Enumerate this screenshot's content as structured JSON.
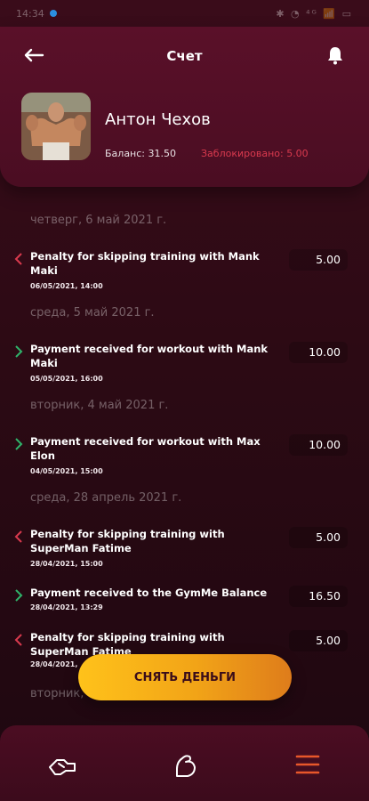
{
  "status_bar": {
    "time": "14:34",
    "right": "✱ ◔ ⁴ᴳ 📶 ▭"
  },
  "header": {
    "title": "Счет",
    "user_name": "Антон Чехов",
    "balance_text": "Баланс: 31.50",
    "blocked_text": "Заблокировано: 5.00"
  },
  "feed": {
    "dates": [
      "четверг, 6 май 2021 г.",
      "среда, 5 май 2021 г.",
      "вторник, 4 май 2021 г.",
      "среда, 28 апрель 2021 г.",
      "вторник,"
    ],
    "transactions": [
      {
        "direction": "out",
        "description": "Penalty for skipping training with Mank Maki",
        "time": "06/05/2021, 14:00",
        "amount": "5.00"
      },
      {
        "direction": "in",
        "description": "Payment received for workout with Mank Maki",
        "time": "05/05/2021, 16:00",
        "amount": "10.00"
      },
      {
        "direction": "in",
        "description": "Payment received for workout with Max Elon",
        "time": "04/05/2021, 15:00",
        "amount": "10.00"
      },
      {
        "direction": "out",
        "description": "Penalty for skipping training with SuperMan Fatime",
        "time": "28/04/2021, 15:00",
        "amount": "5.00"
      },
      {
        "direction": "in",
        "description": "Payment received to the GymMe Balance",
        "time": "28/04/2021, 13:29",
        "amount": "16.50"
      },
      {
        "direction": "out",
        "description": "Penalty for skipping training with SuperMan Fatime",
        "time": "28/04/2021,",
        "amount": "5.00"
      }
    ]
  },
  "withdraw_button": "СНЯТЬ ДЕНЬГИ",
  "colors": {
    "accent": "#f2a417",
    "incoming": "#2fb36a",
    "outgoing": "#d93a4e",
    "menu_active": "#e8572a"
  },
  "tabbar": {
    "icons": [
      "handshake-icon",
      "bicep-icon",
      "menu-icon"
    ]
  }
}
